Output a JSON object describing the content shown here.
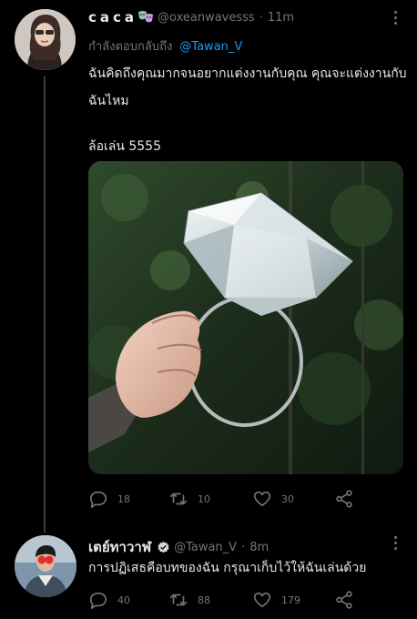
{
  "tweets": [
    {
      "display_name": "caca",
      "display_emoji": "theater-masks-emoji",
      "handle": "@oxeanwavesss",
      "separator": "·",
      "time": "11m",
      "replying_label": "กำลังตอบกลับถึง",
      "replying_to": "@Tawan_V",
      "body_lines": [
        "ฉันคิดถึงคุณมากจนอยากแต่งงานกับคุณ คุณจะแต่งงานกับฉันไหม"
      ],
      "body_line2": "ล้อเล่น 5555",
      "media_description_icon": "diamond-ring-photo",
      "replies": "18",
      "retweets": "10",
      "likes": "30"
    },
    {
      "display_name": "เตย์ทาวาฬ",
      "handle": "@Tawan_V",
      "separator": "·",
      "time": "8m",
      "body": "การปฏิเสธคือบทของฉัน กรุณาเก็บไว้ให้ฉันเล่นด้วย",
      "replies": "40",
      "retweets": "88",
      "likes": "179"
    }
  ],
  "icons": {
    "reply": "reply-icon",
    "retweet": "retweet-icon",
    "like": "heart-icon",
    "share": "share-icon",
    "more": "more-icon",
    "verified": "verified-badge-icon"
  },
  "colors": {
    "background": "#000000",
    "text": "#e7e9ea",
    "secondary": "#71767b",
    "link": "#1d9bf0",
    "thread_line": "#3a3d40"
  }
}
